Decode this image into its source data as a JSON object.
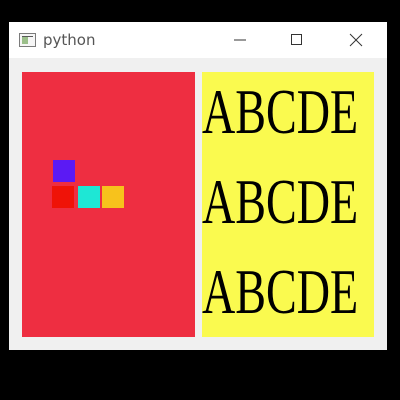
{
  "window": {
    "title": "python",
    "controls": {
      "minimize": "minimize",
      "maximize": "maximize",
      "close": "close"
    }
  },
  "left_panel": {
    "color": "#ee2e41",
    "squares": [
      {
        "name": "purple-square",
        "color": "#5b1af4"
      },
      {
        "name": "red-square",
        "color": "#ef1308"
      },
      {
        "name": "cyan-square",
        "color": "#1ee7d5"
      },
      {
        "name": "yellow-square",
        "color": "#f7c21c"
      }
    ]
  },
  "right_panel": {
    "color": "#fafa4f",
    "lines": [
      "ABCDE",
      "ABCDE",
      "ABCDE"
    ]
  }
}
